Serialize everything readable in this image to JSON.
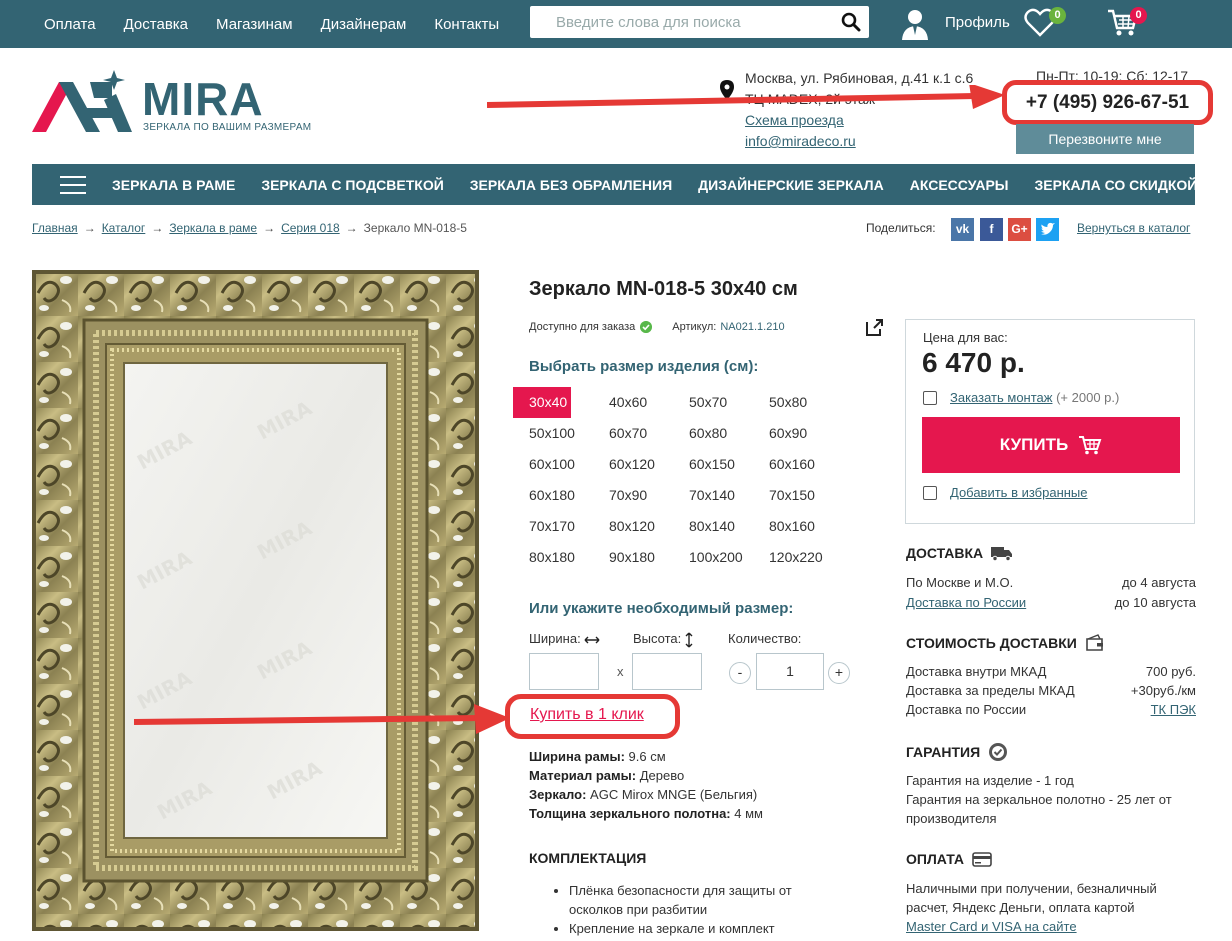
{
  "topnav": {
    "items": [
      "Оплата",
      "Доставка",
      "Магазинам",
      "Дизайнерам",
      "Контакты"
    ]
  },
  "search": {
    "placeholder": "Введите слова для поиска"
  },
  "user": {
    "profile_label": "Профиль",
    "favorites_count": "0",
    "cart_count": "0"
  },
  "logo": {
    "name": "MIRA",
    "tagline": "ЗЕРКАЛА ПО ВАШИМ РАЗМЕРАМ"
  },
  "contact": {
    "address_line1": "Москва, ул. Рябиновая, д.41 к.1 с.6",
    "address_line2": "ТЦ MADEX, 2й этаж",
    "map_link": "Схема проезда",
    "email": "info@miradeco.ru",
    "hours": "Пн-Пт: 10-19; Сб: 12-17",
    "phone": "+7 (495) 926-67-51",
    "callback_label": "Перезвоните мне"
  },
  "mainnav": {
    "items": [
      "ЗЕРКАЛА В РАМЕ",
      "ЗЕРКАЛА С ПОДСВЕТКОЙ",
      "ЗЕРКАЛА БЕЗ ОБРАМЛЕНИЯ",
      "ДИЗАЙНЕРСКИЕ ЗЕРКАЛА",
      "АКСЕССУАРЫ",
      "ЗЕРКАЛА СО СКИДКОЙ"
    ]
  },
  "breadcrumb": {
    "items": [
      "Главная",
      "Каталог",
      "Зеркала в раме",
      "Серия 018",
      "Зеркало MN-018-5"
    ],
    "separator": "→"
  },
  "share": {
    "label": "Поделиться:",
    "networks": [
      "vk",
      "f",
      "G+",
      "twitter"
    ],
    "back_link": "Вернуться в каталог"
  },
  "product": {
    "title": "Зеркало MN-018-5 30x40 см",
    "availability": "Доступно для заказа",
    "sku_label": "Артикул:",
    "sku": "NA021.1.210",
    "sizes_title": "Выбрать размер изделия (см):",
    "sizes": [
      "30x40",
      "40x60",
      "50x70",
      "50x80",
      "50x100",
      "60x70",
      "60x80",
      "60x90",
      "60x100",
      "60x120",
      "60x150",
      "60x160",
      "60x180",
      "70x90",
      "70x140",
      "70x150",
      "70x170",
      "80x120",
      "80x140",
      "80x160",
      "80x180",
      "90x180",
      "100x200",
      "120x220"
    ],
    "selected_size": "30x40",
    "custom_title": "Или укажите необходимый размер:",
    "width_label": "Ширина:",
    "height_label": "Высота:",
    "qty_label": "Количество:",
    "times_sign": "x",
    "minus": "-",
    "plus": "+",
    "quantity": "1",
    "one_click": "Купить в 1 клик",
    "specs": [
      {
        "label": "Ширина рамы:",
        "value": "9.6 см"
      },
      {
        "label": "Материал рамы:",
        "value": "Дерево"
      },
      {
        "label": "Зеркало:",
        "value": "AGC Mirox MNGE (Бельгия)"
      },
      {
        "label": "Толщина зеркального полотна:",
        "value": "4 мм"
      }
    ],
    "kit_title": "КОМПЛЕКТАЦИЯ",
    "kit_items": [
      "Плёнка безопасности для защиты от осколков при разбитии",
      "Крепление на зеркале и комплект"
    ]
  },
  "price": {
    "label": "Цена для вас:",
    "value": "6 470 р.",
    "install_label": "Заказать монтаж",
    "install_extra": "(+ 2000 р.)",
    "buy_label": "КУПИТЬ",
    "favorite_label": "Добавить в избранные"
  },
  "delivery": {
    "title": "ДОСТАВКА",
    "rows": [
      {
        "label": "По Москве и М.О.",
        "value": "до 4 августа"
      },
      {
        "label": "Доставка по России",
        "value": "до 10 августа"
      }
    ]
  },
  "delivery_cost": {
    "title": "СТОИМОСТЬ ДОСТАВКИ",
    "rows": [
      {
        "label": "Доставка внутри МКАД",
        "value": "700 руб."
      },
      {
        "label": "Доставка за пределы МКАД",
        "value": "+30руб./км"
      },
      {
        "label": "Доставка по России",
        "value": "ТК ПЭК"
      }
    ]
  },
  "warranty": {
    "title": "ГАРАНТИЯ",
    "line1": "Гарантия на изделие - 1 год",
    "line2": "Гарантия на зеркальное полотно - 25 лет от производителя"
  },
  "payment": {
    "title": "ОПЛАТА",
    "text": "Наличными при получении, безналичный расчет, Яндекс Деньги, оплата картой",
    "link": "Master Card и VISA на сайте"
  },
  "colors": {
    "primary": "#336473",
    "accent": "#e5174e",
    "highlight": "#e53935"
  }
}
